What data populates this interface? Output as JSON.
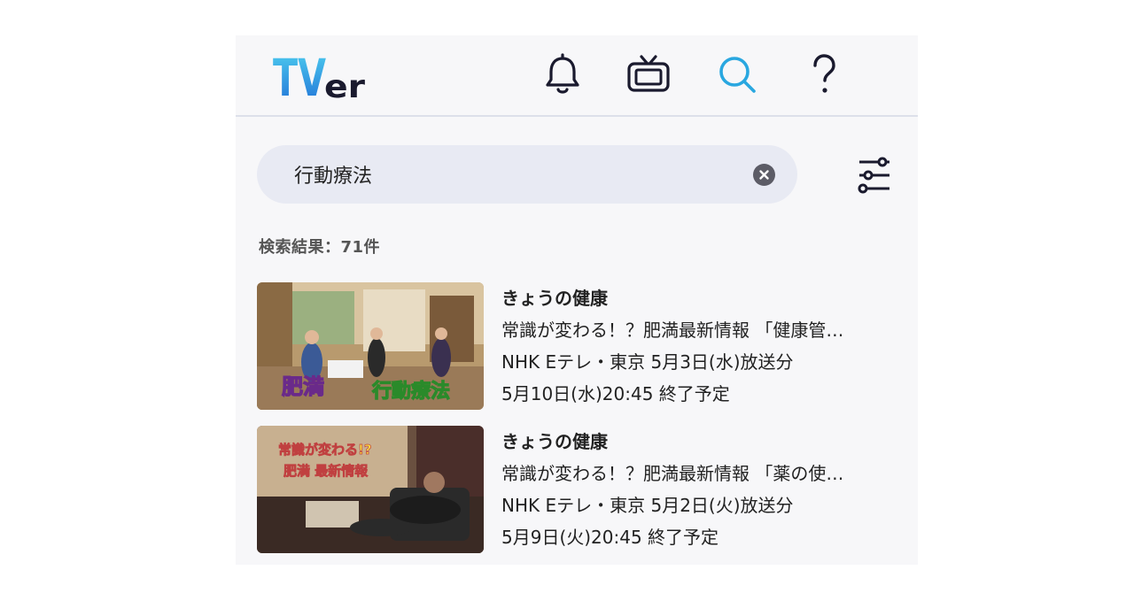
{
  "header": {
    "logo_text_tv": "TV",
    "logo_text_er": "er",
    "icons": [
      "bell-icon",
      "tv-icon",
      "search-icon",
      "help-icon"
    ],
    "active_icon": "search-icon",
    "accent_color": "#29a7e0"
  },
  "search": {
    "value": "行動療法",
    "placeholder": ""
  },
  "results": {
    "count_label": "検索結果：71件",
    "items": [
      {
        "title": "きょうの健康",
        "episode": "常識が変わる！？肥満最新情報 「健康管…",
        "broadcast": "NHK Eテレ・東京 5月3日(水)放送分",
        "expiry": "5月10日(水)20:45 終了予定",
        "thumb_caption_1": "肥満",
        "thumb_caption_2": "行動療法"
      },
      {
        "title": "きょうの健康",
        "episode": "常識が変わる！？肥満最新情報 「薬の使…",
        "broadcast": "NHK Eテレ・東京 5月2日(火)放送分",
        "expiry": "5月9日(火)20:45 終了予定",
        "thumb_caption_1": "常識が変わる!?",
        "thumb_caption_2": "肥満 最新情報"
      }
    ]
  }
}
